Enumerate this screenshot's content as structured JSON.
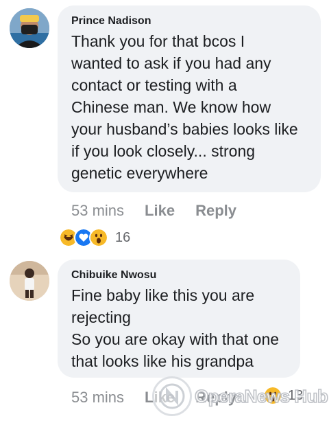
{
  "comments": [
    {
      "author": "Prince Nadison",
      "lines": [
        "Thank you for that bcos I",
        "wanted to ask if you had any",
        "contact or testing with a",
        "Chinese man. We know how",
        "your husband’s babies looks like",
        "if you look closely... strong",
        "genetic everywhere"
      ],
      "time": "53 mins",
      "like_label": "Like",
      "reply_label": "Reply",
      "reaction_icons": [
        "haha-icon",
        "love-icon",
        "wow-icon"
      ],
      "reaction_count": "16"
    },
    {
      "author": "Chibuike Nwosu",
      "lines": [
        "Fine baby like this you are",
        "rejecting",
        "So you are okay with that one",
        "that looks like his grandpa"
      ],
      "time": "53 mins",
      "like_label": "Like",
      "reply_label": "Reply",
      "reaction_count_partial": "13"
    }
  ],
  "watermark": {
    "text": "OperaNews Hub",
    "logo_icon": "opera-news-logo-icon"
  },
  "colors": {
    "bubble": "#f0f2f5",
    "meta_text": "#8a8d91",
    "haha": "#f7b928",
    "love": "#1877f2",
    "wow": "#f7b928"
  }
}
